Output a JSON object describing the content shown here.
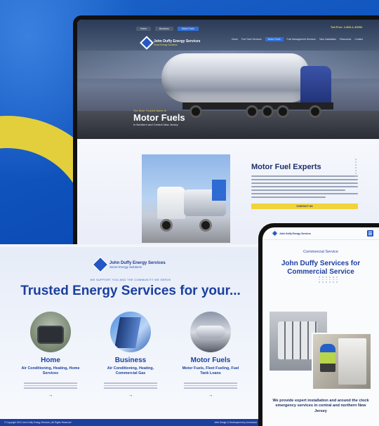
{
  "colors": {
    "background": "#0c4db8",
    "accent_yellow": "#e3cf3c",
    "brand_navy": "#1c3f9e",
    "button_yellow": "#f0d43c"
  },
  "desktop": {
    "nav_top": [
      "Home",
      "Business",
      "Motor Fuels"
    ],
    "nav_phone": "Toll Free: 1-800-1-JOHN",
    "nav_main": [
      "Home",
      "Fuel Tank Services",
      "Motor Fuels",
      "Fuel Management Services",
      "Tank Installation",
      "Resources",
      "Contact"
    ],
    "logo_name": "John Duffy Energy Services",
    "logo_tagline": "Smart Energy Solutions",
    "hero_eyebrow": "The Most Trusted Name In",
    "hero_title": "Motor Fuels",
    "hero_sub": "in Northern and Central New Jersey",
    "expert_title": "Motor Fuel Experts",
    "expert_button": "CONTACT US"
  },
  "front": {
    "logo_name": "John Duffy Energy Services",
    "logo_tagline": "Smart Energy Solutions",
    "tagline": "WE SUPPORT YOU AND THE COMMUNITY WE SERVE",
    "title": "Trusted Energy Services for your...",
    "cards": [
      {
        "title": "Home",
        "sub": "Air Conditioning, Heating, Home Services",
        "image_icon": "hvac-unit-icon"
      },
      {
        "title": "Business",
        "sub": "Air Conditioning, Heating, Commercial Gas",
        "image_icon": "office-building-icon"
      },
      {
        "title": "Motor Fuels",
        "sub": "Motor Fuels, Fleet Fueling, Fuel Tank Loans",
        "image_icon": "fuel-truck-icon"
      }
    ],
    "card_arrow": "→",
    "footer_left": "© Copyright 2024 John Duffy Energy Services | All Rights Reserved",
    "footer_right": "Web Design & Development by Arrowhead"
  },
  "phone": {
    "logo_name": "John Duffy Energy Services",
    "eyebrow": "Commercial Service",
    "title": "John Duffy Services for Commercial Service",
    "bottom_text": "We provide expert installation and around the clock emergency services in central and northern New Jersey"
  }
}
